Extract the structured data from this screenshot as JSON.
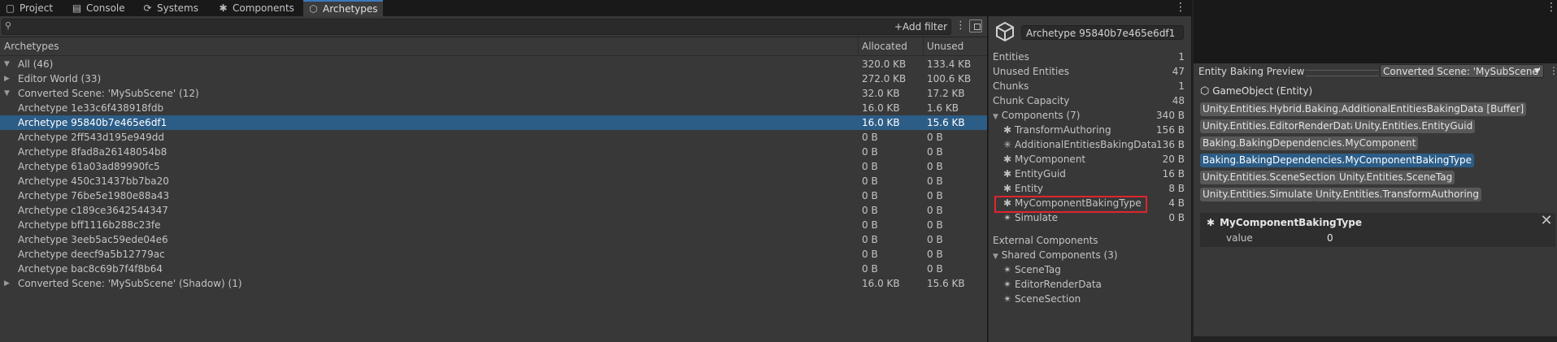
{
  "tabs": [
    {
      "label": "Project",
      "icon": "folder-icon"
    },
    {
      "label": "Console",
      "icon": "console-icon"
    },
    {
      "label": "Systems",
      "icon": "systems-icon"
    },
    {
      "label": "Components",
      "icon": "puzzle-icon"
    },
    {
      "label": "Archetypes",
      "icon": "archetype-icon",
      "active": true
    }
  ],
  "toolbar": {
    "add_filter": "+Add filter",
    "search_value": ""
  },
  "tree": {
    "columns": {
      "name": "Archetypes",
      "allocated": "Allocated",
      "unused": "Unused"
    },
    "rows": [
      {
        "name": "All (46)",
        "allocated": "320.0 KB",
        "unused": "133.4 KB",
        "indent": 0,
        "expander": "open"
      },
      {
        "name": "Editor World (33)",
        "allocated": "272.0 KB",
        "unused": "100.6 KB",
        "indent": 0,
        "expander": "closed"
      },
      {
        "name": "Converted Scene: 'MySubScene' (12)",
        "allocated": "32.0 KB",
        "unused": "17.2 KB",
        "indent": 0,
        "expander": "open"
      },
      {
        "name": "Archetype 1e33c6f438918fdb",
        "allocated": "16.0 KB",
        "unused": "1.6 KB",
        "indent": 1
      },
      {
        "name": "Archetype 95840b7e465e6df1",
        "allocated": "16.0 KB",
        "unused": "15.6 KB",
        "indent": 1,
        "selected": true
      },
      {
        "name": "Archetype 2ff543d195e949dd",
        "allocated": "0 B",
        "unused": "0 B",
        "indent": 1
      },
      {
        "name": "Archetype 8fad8a26148054b8",
        "allocated": "0 B",
        "unused": "0 B",
        "indent": 1
      },
      {
        "name": "Archetype 61a03ad89990fc5",
        "allocated": "0 B",
        "unused": "0 B",
        "indent": 1
      },
      {
        "name": "Archetype 450c31437bb7ba20",
        "allocated": "0 B",
        "unused": "0 B",
        "indent": 1
      },
      {
        "name": "Archetype 76be5e1980e88a43",
        "allocated": "0 B",
        "unused": "0 B",
        "indent": 1
      },
      {
        "name": "Archetype c189ce3642544347",
        "allocated": "0 B",
        "unused": "0 B",
        "indent": 1
      },
      {
        "name": "Archetype bff1116b288c23fe",
        "allocated": "0 B",
        "unused": "0 B",
        "indent": 1
      },
      {
        "name": "Archetype 3eeb5ac59ede04e6",
        "allocated": "0 B",
        "unused": "0 B",
        "indent": 1
      },
      {
        "name": "Archetype deecf9a5b12779ac",
        "allocated": "0 B",
        "unused": "0 B",
        "indent": 1
      },
      {
        "name": "Archetype bac8c69b7f4f8b64",
        "allocated": "0 B",
        "unused": "0 B",
        "indent": 1
      },
      {
        "name": "Converted Scene: 'MySubScene' (Shadow) (1)",
        "allocated": "16.0 KB",
        "unused": "15.6 KB",
        "indent": 0,
        "expander": "closed"
      }
    ]
  },
  "details": {
    "archetype_name": "Archetype 95840b7e465e6df1",
    "stats": [
      {
        "label": "Entities",
        "value": "1"
      },
      {
        "label": "Unused Entities",
        "value": "47"
      },
      {
        "label": "Chunks",
        "value": "1"
      },
      {
        "label": "Chunk Capacity",
        "value": "48"
      }
    ],
    "components_header": {
      "label": "Components (7)",
      "value": "340 B"
    },
    "components": [
      {
        "label": "TransformAuthoring",
        "value": "156 B",
        "icon": "component-icon"
      },
      {
        "label": "AdditionalEntitiesBakingData",
        "value": "136 B",
        "icon": "buffer-component-icon"
      },
      {
        "label": "MyComponent",
        "value": "20 B",
        "icon": "component-icon"
      },
      {
        "label": "EntityGuid",
        "value": "16 B",
        "icon": "component-icon"
      },
      {
        "label": "Entity",
        "value": "8 B",
        "icon": "component-icon"
      },
      {
        "label": "MyComponentBakingType",
        "value": "4 B",
        "icon": "component-icon",
        "highlighted": true
      },
      {
        "label": "Simulate",
        "value": "0 B",
        "icon": "tag-component-icon"
      }
    ],
    "external_header": "External Components",
    "shared_header": "Shared Components (3)",
    "shared": [
      {
        "label": "SceneTag",
        "icon": "shared-component-icon"
      },
      {
        "label": "EditorRenderData",
        "icon": "shared-component-icon"
      },
      {
        "label": "SceneSection",
        "icon": "shared-component-icon"
      }
    ]
  },
  "baking": {
    "title": "Entity Baking Preview",
    "dropdown": "Converted Scene: 'MySubScene'",
    "gameobject": "GameObject (Entity)",
    "chips": [
      {
        "label": "Unity.Entities.Hybrid.Baking.AdditionalEntitiesBakingData [Buffer]",
        "selected": false
      },
      {
        "label": "Unity.Entities.EditorRenderData",
        "selected": false
      },
      {
        "label": "Unity.Entities.EntityGuid",
        "selected": false
      },
      {
        "label": "Baking.BakingDependencies.MyComponent",
        "selected": false
      },
      {
        "label": "Baking.BakingDependencies.MyComponentBakingType",
        "selected": true
      },
      {
        "label": "Unity.Entities.SceneSection",
        "selected": false
      },
      {
        "label": "Unity.Entities.SceneTag",
        "selected": false
      },
      {
        "label": "Unity.Entities.Simulate",
        "selected": false
      },
      {
        "label": "Unity.Entities.TransformAuthoring",
        "selected": false
      }
    ],
    "inspector": {
      "title": "MyComponentBakingType",
      "field": "value",
      "value": "0"
    }
  },
  "colors": {
    "selection": "#2c5d87",
    "highlight_box": "#e0252b",
    "panel": "#383838",
    "tab_accent": "#3a79bb"
  }
}
